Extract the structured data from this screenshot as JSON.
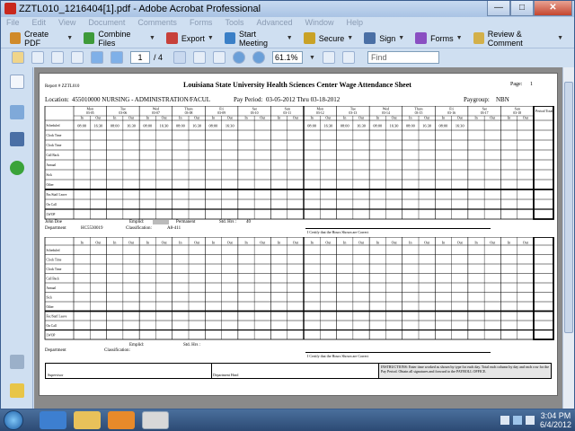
{
  "window": {
    "title": "ZZTL010_1216404[1].pdf - Adobe Acrobat Professional",
    "buttons": {
      "minimize": "—",
      "maximize": "□",
      "close": "✕"
    }
  },
  "menubar": [
    "File",
    "Edit",
    "View",
    "Document",
    "Comments",
    "Forms",
    "Tools",
    "Advanced",
    "Window",
    "Help"
  ],
  "toolbar1": [
    {
      "label": "Create PDF",
      "icon": "create-pdf-icon",
      "color": "#d08a2a"
    },
    {
      "label": "Combine Files",
      "icon": "combine-files-icon",
      "color": "#3e9a3a"
    },
    {
      "label": "Export",
      "icon": "export-icon",
      "color": "#c7403a"
    },
    {
      "label": "Start Meeting",
      "icon": "meeting-icon",
      "color": "#3a7fc7"
    },
    {
      "label": "Secure",
      "icon": "lock-icon",
      "color": "#c9a227"
    },
    {
      "label": "Sign",
      "icon": "pen-icon",
      "color": "#4a6fa5"
    },
    {
      "label": "Forms",
      "icon": "forms-icon",
      "color": "#8a4fc2"
    },
    {
      "label": "Review & Comment",
      "icon": "review-icon",
      "color": "#d3b04a"
    }
  ],
  "toolbar2": {
    "current_page": "1",
    "total_pages": "/ 4",
    "zoom": "61.1%",
    "find_placeholder": "Find"
  },
  "pdf": {
    "header_left": "Report # ZZTL010",
    "title": "Louisiana State University Health Sciences Center Wage Attendance Sheet",
    "page_label": "Page:",
    "page_number": "1",
    "location_label": "Location:",
    "location_value": "455010000  NURSING - ADMINISTRATION/FACUL",
    "pay_period_label": "Pay Period:",
    "pay_period_value": "03-05-2012  Thru  03-18-2012",
    "paygroup_label": "Paygroup:",
    "paygroup_value": "NBN",
    "days": [
      {
        "name": "Mon",
        "date": "03-05"
      },
      {
        "name": "Tue",
        "date": "03-06"
      },
      {
        "name": "Wed",
        "date": "03-07"
      },
      {
        "name": "Thurs",
        "date": "03-08"
      },
      {
        "name": "Fri",
        "date": "03-09"
      },
      {
        "name": "Sat",
        "date": "03-10"
      },
      {
        "name": "Sun",
        "date": "03-11"
      },
      {
        "name": "Mon",
        "date": "03-12"
      },
      {
        "name": "Tue",
        "date": "03-13"
      },
      {
        "name": "Wed",
        "date": "03-14"
      },
      {
        "name": "Thurs",
        "date": "03-15"
      },
      {
        "name": "Fri",
        "date": "03-16"
      },
      {
        "name": "Sat",
        "date": "03-17"
      },
      {
        "name": "Sun",
        "date": "03-18"
      }
    ],
    "period_total_label": "Period Total",
    "in_label": "In",
    "out_label": "Out",
    "row_labels": [
      "Scheduled",
      "Clock Time",
      "Clock Time",
      "Call Back",
      "Annual",
      "Sick",
      "Other",
      "Fac/Staff Leave",
      "On Call",
      "LWOP"
    ],
    "scheduled_times": [
      "08:00",
      "16:30"
    ],
    "scheduled_days": [
      0,
      1,
      2,
      3,
      4,
      7,
      8,
      9,
      10,
      11
    ],
    "emp1": {
      "name_label": "John Doe",
      "emplid_label": "Emplid:",
      "status": "Permanent",
      "fte_label": "Std. Hrs :",
      "fte_value": "40",
      "dept_label": "Department",
      "dept_value": "HC5530019",
      "class_label": "Classification:",
      "class_value": "A8-411"
    },
    "emp2": {
      "emplid_label": "Emplid:",
      "fte_label": "Std. Hrs :",
      "dept_label": "Department",
      "class_label": "Classification:"
    },
    "sign_caption": "I Certify that the Hours Shown are Correct",
    "supervisor_label": "Supervisor",
    "dept_head_label": "Department Head",
    "instructions": "INSTRUCTIONS: Enter time worked as shown by type for each day. Total each column by day and each row for the Pay Period. Obtain all signatures and forward to the PAYROLL OFFICE."
  },
  "taskbar": {
    "time": "3:04 PM",
    "date": "6/4/2012"
  }
}
